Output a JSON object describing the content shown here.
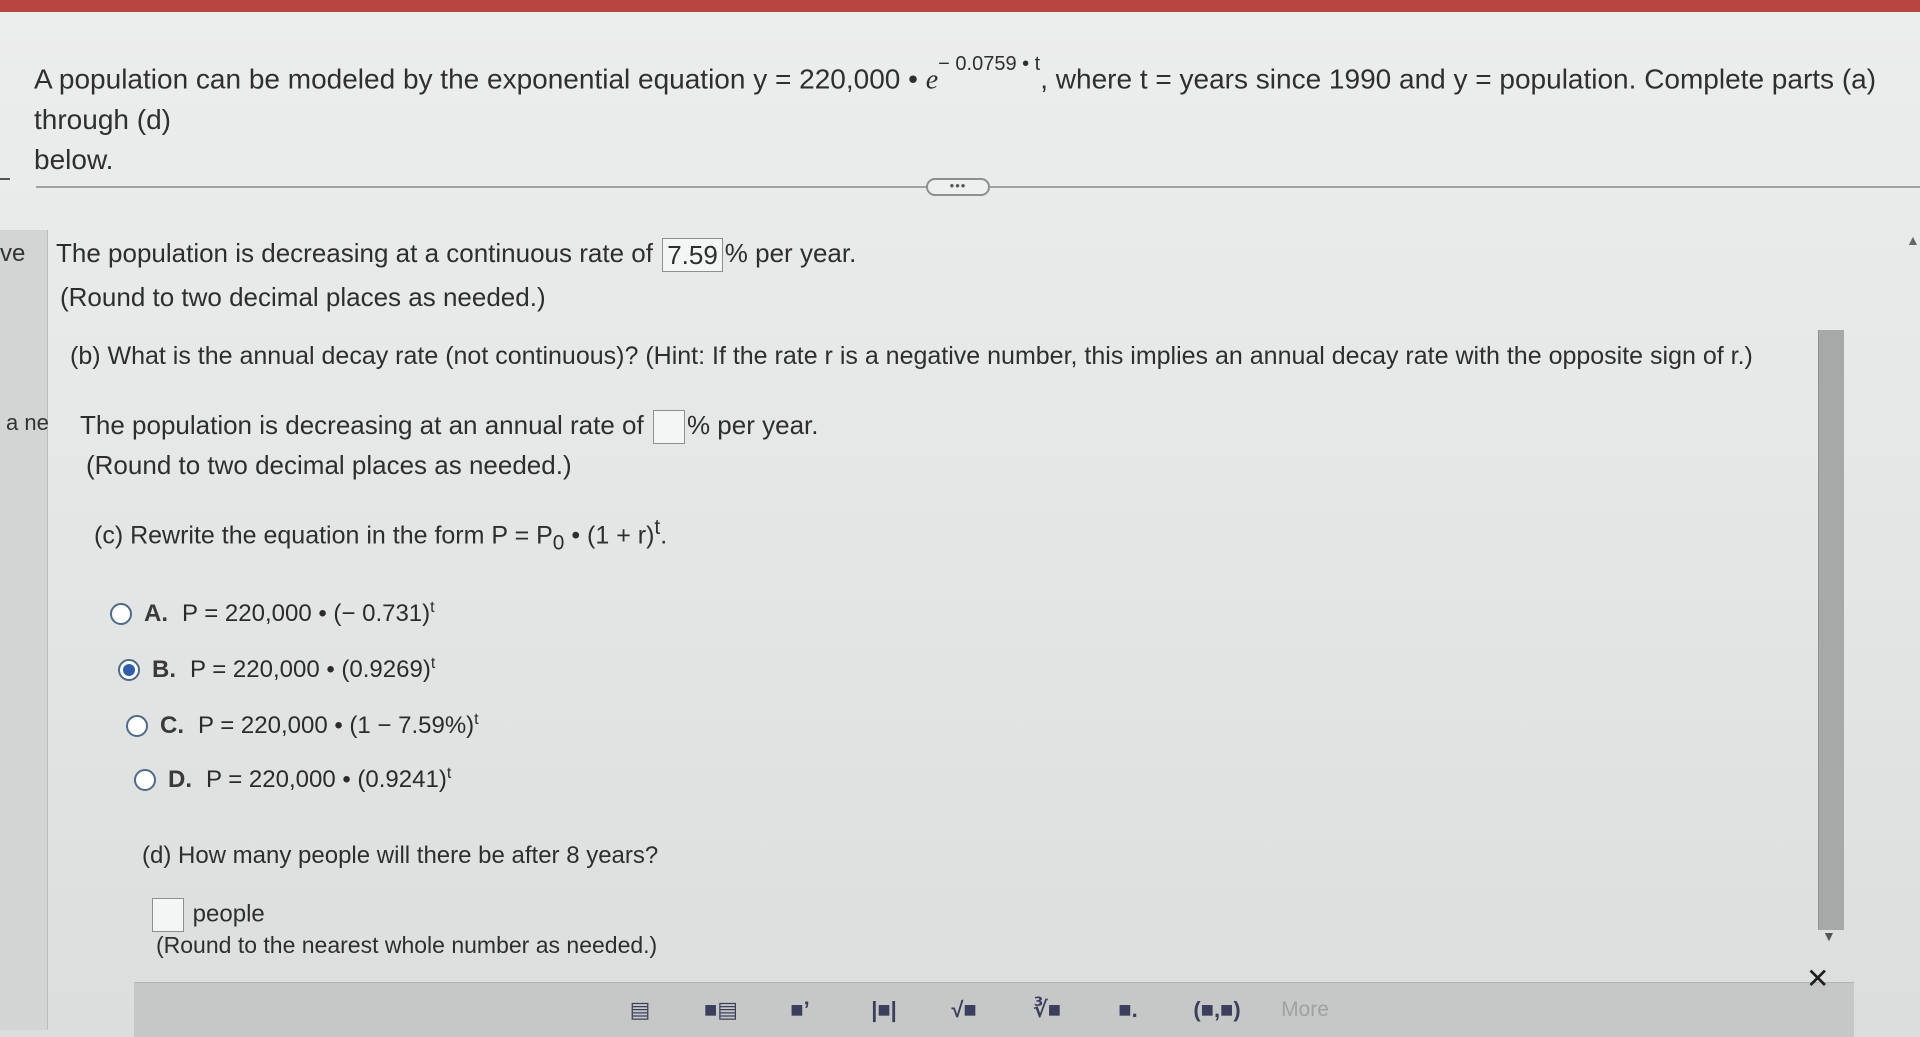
{
  "question": {
    "part1": "A population can be modeled by the exponential equation y = 220,000 • ",
    "base": "e",
    "exponent": "− 0.0759 • t",
    "part2": ", where t = years since 1990 and y = population. Complete parts (a) through (d)",
    "part3": "below."
  },
  "more_pill": "•••",
  "edge": {
    "left1": "ve",
    "left2": "a ne"
  },
  "part_a": {
    "before": "The population is decreasing at a continuous rate of",
    "value": "7.59",
    "after": "% per year.",
    "note": "(Round to two decimal places as needed.)"
  },
  "part_b": {
    "question": "(b) What is the annual decay rate (not continuous)? (Hint: If the rate r is a negative number, this implies an annual decay rate with the opposite sign of r.)",
    "before": "The population is decreasing at an annual rate of",
    "value": "",
    "after": "% per year.",
    "note": "(Round to two decimal places as needed.)"
  },
  "part_c": {
    "question_pre": "(c) Rewrite the equation in the form P = P",
    "question_sub": "0",
    "question_mid": " • (1 + r)",
    "question_sup": "t",
    "question_end": ".",
    "options": [
      {
        "letter": "A.",
        "formula": "P = 220,000 • (− 0.731)",
        "sup": "t",
        "selected": false
      },
      {
        "letter": "B.",
        "formula": "P = 220,000 • (0.9269)",
        "sup": "t",
        "selected": true
      },
      {
        "letter": "C.",
        "formula": "P = 220,000 • (1 − 7.59%)",
        "sup": "t",
        "selected": false
      },
      {
        "letter": "D.",
        "formula": "P = 220,000 • (0.9241)",
        "sup": "t",
        "selected": false
      }
    ]
  },
  "part_d": {
    "question": "(d) How many people will there be after 8 years?",
    "value": "",
    "unit": "people",
    "note": "(Round to the nearest whole number as needed.)"
  },
  "toolbar": {
    "buttons": [
      "fraction-icon",
      "mixed-number-icon",
      "exponent-icon",
      "absolute-value-icon",
      "sqrt-icon",
      "nth-root-icon",
      "decimal-icon",
      "ordered-pair-icon"
    ],
    "glyphs": [
      "▤",
      "■▤",
      "■’",
      "|■|",
      "√■",
      "∛■",
      "■.",
      "(■,■)"
    ],
    "more_label": "More",
    "close": "✕"
  }
}
